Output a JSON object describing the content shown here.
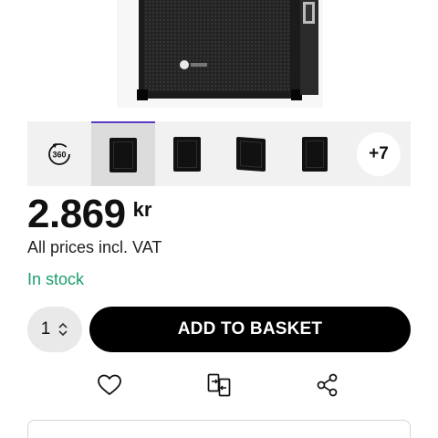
{
  "product": {
    "image_alt": "speaker-cabinet",
    "thumbnails": [
      {
        "type": "360-view",
        "label": "360"
      },
      {
        "type": "image",
        "selected": true
      },
      {
        "type": "image",
        "selected": false
      },
      {
        "type": "image",
        "selected": false
      },
      {
        "type": "image",
        "selected": false
      }
    ],
    "more_images_label": "+7"
  },
  "price": {
    "amount": "2.869",
    "currency": "kr",
    "vat_note": "All prices incl. VAT"
  },
  "availability": {
    "status": "In stock",
    "color": "#1a9e6a"
  },
  "purchase": {
    "quantity": "1",
    "add_to_basket_label": "ADD TO BASKET"
  },
  "actions": {
    "wishlist_icon": "heart-icon",
    "compare_icon": "compare-icon",
    "share_icon": "share-icon"
  },
  "colors": {
    "accent": "#5b3cc4",
    "button": "#000000",
    "in_stock": "#1a9e6a"
  }
}
